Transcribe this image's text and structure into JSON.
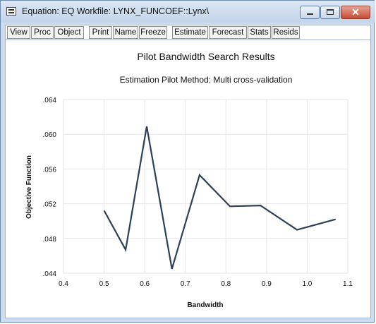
{
  "window": {
    "title": "Equation: EQ   Workfile: LYNX_FUNCOEF::Lynx\\",
    "controls": {
      "minimize": "",
      "maximize": "",
      "close": "✕"
    }
  },
  "toolbar": {
    "buttons": [
      "View",
      "Proc",
      "Object",
      "Print",
      "Name",
      "Freeze",
      "Estimate",
      "Forecast",
      "Stats",
      "Resids"
    ]
  },
  "chart_data": {
    "type": "line",
    "title": "Pilot Bandwidth Search Results",
    "subtitle": "Estimation Pilot Method: Multi cross-validation",
    "xlabel": "Bandwidth",
    "ylabel": "Objective Function",
    "xlim": [
      0.4,
      1.1
    ],
    "ylim": [
      0.044,
      0.064
    ],
    "x_ticks": [
      "0.4",
      "0.5",
      "0.6",
      "0.7",
      "0.8",
      "0.9",
      "1.0",
      "1.1"
    ],
    "y_ticks": [
      ".044",
      ".048",
      ".052",
      ".056",
      ".060",
      ".064"
    ],
    "grid": true,
    "line_color": "#2f4056",
    "series": [
      {
        "x": [
          0.5,
          0.553,
          0.605,
          0.667,
          0.735,
          0.81,
          0.885,
          0.975,
          1.07
        ],
        "values": [
          0.0512,
          0.0467,
          0.0609,
          0.0445,
          0.0553,
          0.0517,
          0.0518,
          0.049,
          0.0502
        ]
      }
    ]
  }
}
